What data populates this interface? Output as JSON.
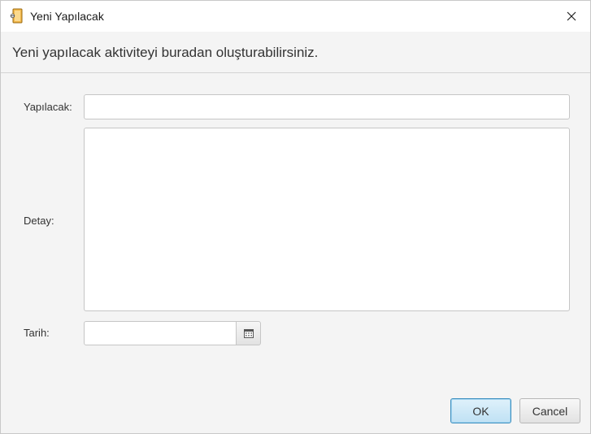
{
  "window": {
    "title": "Yeni Yapılacak",
    "app_icon": "notebook-icon",
    "close_icon": "close-icon"
  },
  "header": {
    "text": "Yeni yapılacak aktiviteyi buradan oluşturabilirsiniz."
  },
  "form": {
    "todo_label": "Yapılacak:",
    "todo_value": "",
    "detail_label": "Detay:",
    "detail_value": "",
    "date_label": "Tarih:",
    "date_value": "",
    "calendar_icon": "calendar-icon"
  },
  "buttons": {
    "ok": "OK",
    "cancel": "Cancel"
  },
  "colors": {
    "ok_border": "#3c8fbf",
    "ok_fill": "#cfe9f8",
    "dialog_bg": "#f4f4f4"
  }
}
